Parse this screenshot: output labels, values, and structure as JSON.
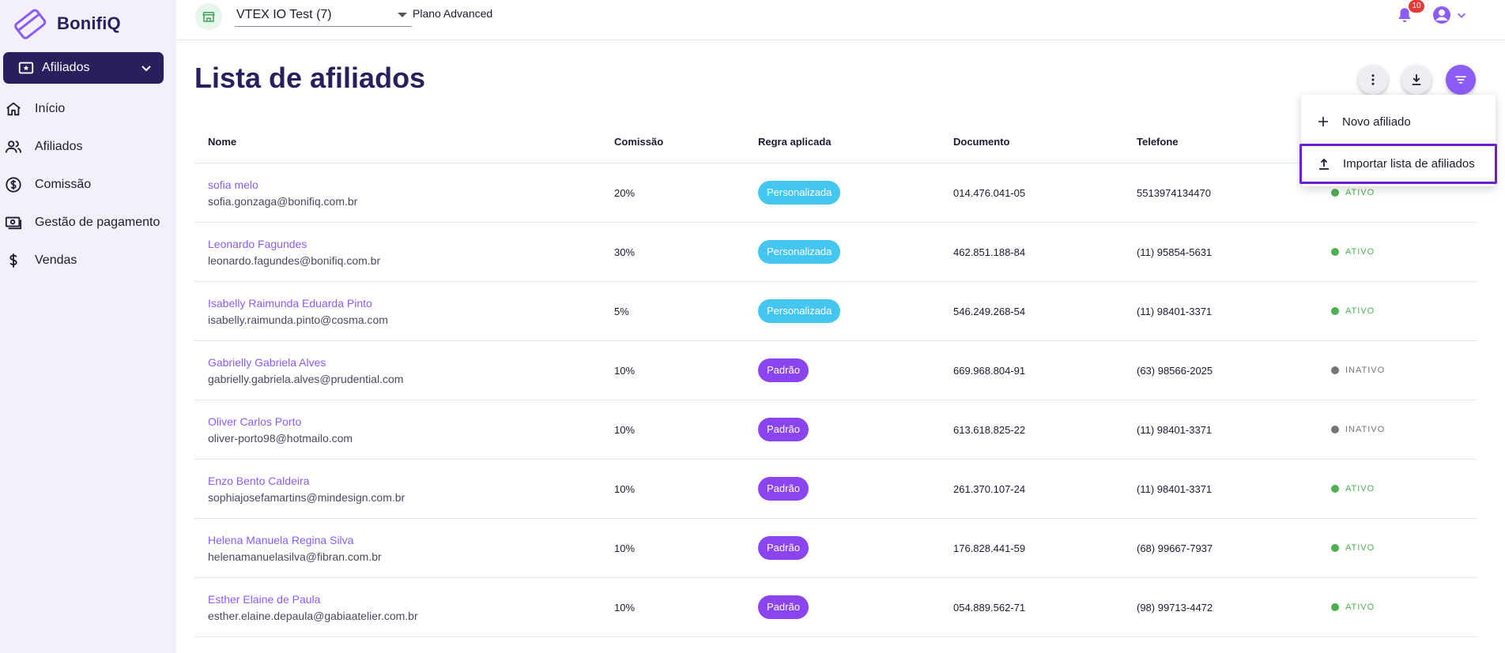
{
  "brand": {
    "name": "BonifiQ",
    "primary": "#2a1f5c",
    "accent": "#8b5cf6"
  },
  "sidebar": {
    "section": {
      "label": "Afiliados",
      "icon": "ticket-icon"
    },
    "items": [
      {
        "label": "Início",
        "icon": "home-icon"
      },
      {
        "label": "Afiliados",
        "icon": "users-icon"
      },
      {
        "label": "Comissão",
        "icon": "dollar-circle-icon"
      },
      {
        "label": "Gestão de pagamento",
        "icon": "cash-icon"
      },
      {
        "label": "Vendas",
        "icon": "dollar-icon"
      }
    ]
  },
  "topbar": {
    "store": "VTEX IO Test (7)",
    "plan": "Plano Advanced",
    "notifications": "10"
  },
  "page": {
    "title": "Lista de afiliados",
    "columns": [
      "Nome",
      "Comissão",
      "Regra aplicada",
      "Documento",
      "Telefone",
      ""
    ],
    "rows": [
      {
        "name": "sofia melo",
        "email": "sofia.gonzaga@bonifiq.com.br",
        "commission": "20%",
        "rule": "Personalizada",
        "document": "014.476.041-05",
        "phone": "5513974134470",
        "status": "ATIVO"
      },
      {
        "name": "Leonardo Fagundes",
        "email": "leonardo.fagundes@bonifiq.com.br",
        "commission": "30%",
        "rule": "Personalizada",
        "document": "462.851.188-84",
        "phone": "(11) 95854-5631",
        "status": "ATIVO"
      },
      {
        "name": "Isabelly Raimunda Eduarda Pinto",
        "email": "isabelly.raimunda.pinto@cosma.com",
        "commission": "5%",
        "rule": "Personalizada",
        "document": "546.249.268-54",
        "phone": "(11) 98401-3371",
        "status": "ATIVO"
      },
      {
        "name": "Gabrielly Gabriela Alves",
        "email": "gabrielly.gabriela.alves@prudential.com",
        "commission": "10%",
        "rule": "Padrão",
        "document": "669.968.804-91",
        "phone": "(63) 98566-2025",
        "status": "INATIVO"
      },
      {
        "name": "Oliver Carlos Porto",
        "email": "oliver-porto98@hotmailo.com",
        "commission": "10%",
        "rule": "Padrão",
        "document": "613.618.825-22",
        "phone": "(11) 98401-3371",
        "status": "INATIVO"
      },
      {
        "name": "Enzo Bento Caldeira",
        "email": "sophiajosefamartins@mindesign.com.br",
        "commission": "10%",
        "rule": "Padrão",
        "document": "261.370.107-24",
        "phone": "(11) 98401-3371",
        "status": "ATIVO"
      },
      {
        "name": "Helena Manuela Regina Silva",
        "email": "helenamanuelasilva@fibran.com.br",
        "commission": "10%",
        "rule": "Padrão",
        "document": "176.828.441-59",
        "phone": "(68) 99667-7937",
        "status": "ATIVO"
      },
      {
        "name": "Esther Elaine de Paula",
        "email": "esther.elaine.depaula@gabiaatelier.com.br",
        "commission": "10%",
        "rule": "Padrão",
        "document": "054.889.562-71",
        "phone": "(98) 99713-4472",
        "status": "ATIVO"
      }
    ]
  },
  "menu": {
    "new_affiliate": "Novo afiliado",
    "import_list": "Importar lista de afiliados"
  },
  "colors": {
    "rule_custom": "#45c6f0",
    "rule_default": "#8b45f0",
    "status_active": "#4caf50",
    "status_inactive": "#757575"
  }
}
